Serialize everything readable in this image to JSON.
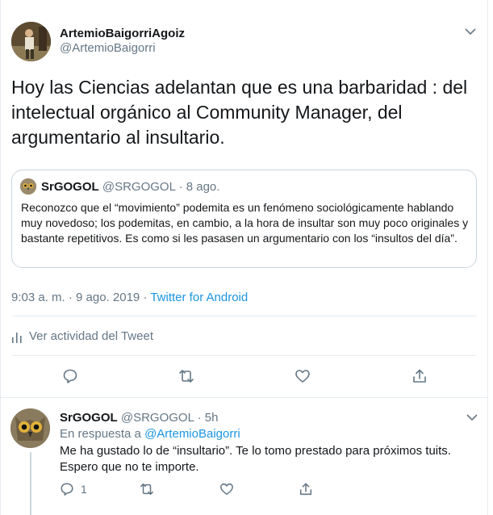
{
  "main_tweet": {
    "author_name": "ArtemioBaigorriAgoiz",
    "author_handle": "@ArtemioBaigorri",
    "text": "Hoy las Ciencias adelantan que es una barbaridad : del intelectual orgánico al Community Manager, del argumentario al insultario.",
    "quoted": {
      "author_name": "SrGOGOL",
      "author_handle": "@SRGOGOL",
      "separator": "·",
      "date": "8 ago.",
      "text": "Reconozco que el “movimiento” podemita es un fenómeno sociológicamente hablando muy novedoso; los podemitas, en cambio, a la hora de insultar son muy poco originales y bastante repetitivos. Es como si les pasasen un argumentario con los “insultos del día”."
    },
    "timestamp": "9:03 a. m. · 9 ago. 2019 · ",
    "source": "Twitter for Android",
    "activity_label": "Ver actividad del Tweet",
    "icons": {
      "more": "chevron-down-icon",
      "activity": "bar-chart-icon",
      "reply": "comment-icon",
      "retweet": "retweet-icon",
      "like": "heart-icon",
      "share": "share-icon"
    }
  },
  "reply": {
    "author_name": "SrGOGOL",
    "author_handle": "@SRGOGOL",
    "separator": "·",
    "time": "5h",
    "in_reply_prefix": "En respuesta a ",
    "in_reply_handle": "@ArtemioBaigorri",
    "text_line1": "Me ha gustado lo de “insultario”. Te lo tomo prestado para próximos tuits.",
    "text_line2": "Espero que no te importe.",
    "reply_count": "1"
  },
  "colors": {
    "text": "#14171a",
    "muted": "#657786",
    "link": "#1b95e0",
    "border": "#e6ecf0"
  }
}
